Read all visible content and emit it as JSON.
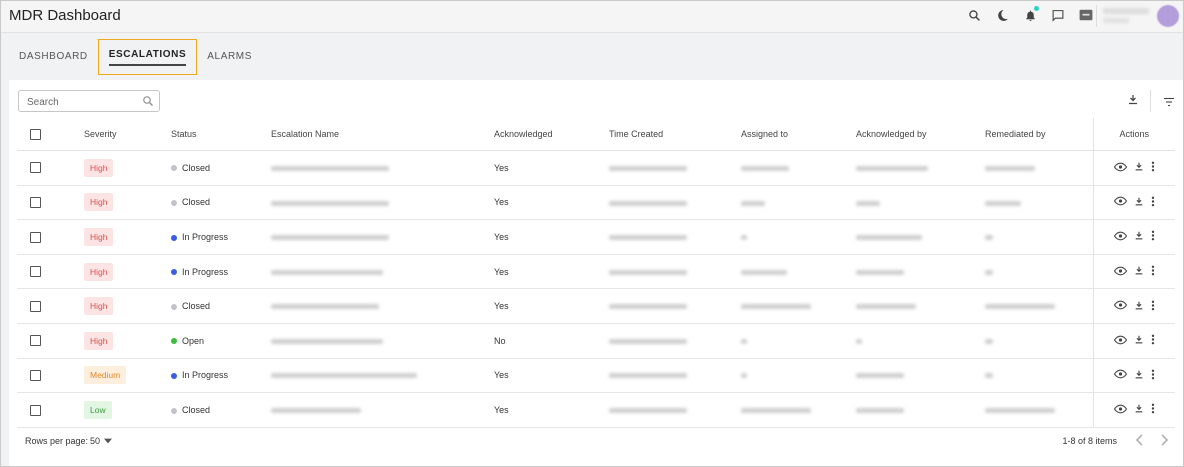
{
  "app": {
    "title": "MDR Dashboard"
  },
  "header_icons": [
    "search-icon",
    "moon-icon",
    "bell-icon",
    "chat-icon",
    "sdc-badge-icon"
  ],
  "tabs": [
    {
      "label": "DASHBOARD",
      "active": false
    },
    {
      "label": "ESCALATIONS",
      "active": true
    },
    {
      "label": "ALARMS",
      "active": false
    }
  ],
  "search": {
    "placeholder": "Search"
  },
  "columns": {
    "severity": "Severity",
    "status": "Status",
    "name": "Escalation Name",
    "acknowledged": "Acknowledged",
    "time_created": "Time Created",
    "assigned_to": "Assigned to",
    "acknowledged_by": "Acknowledged by",
    "remediated_by": "Remediated by",
    "actions": "Actions"
  },
  "rows": [
    {
      "severity": "High",
      "status": "Closed",
      "acknowledged": "Yes"
    },
    {
      "severity": "High",
      "status": "Closed",
      "acknowledged": "Yes"
    },
    {
      "severity": "High",
      "status": "In Progress",
      "acknowledged": "Yes"
    },
    {
      "severity": "High",
      "status": "In Progress",
      "acknowledged": "Yes"
    },
    {
      "severity": "High",
      "status": "Closed",
      "acknowledged": "Yes"
    },
    {
      "severity": "High",
      "status": "Open",
      "acknowledged": "No"
    },
    {
      "severity": "Medium",
      "status": "In Progress",
      "acknowledged": "Yes"
    },
    {
      "severity": "Low",
      "status": "Closed",
      "acknowledged": "Yes"
    }
  ],
  "footer": {
    "rows_per_page_label": "Rows per page:",
    "rows_per_page_value": "50",
    "range": "1-8 of 8 items"
  },
  "colors": {
    "accent_tab_border": "#f0a81f",
    "status_closed": "#c2c2cc",
    "status_in_progress": "#3a5ce6",
    "status_open": "#3cbd3c"
  }
}
